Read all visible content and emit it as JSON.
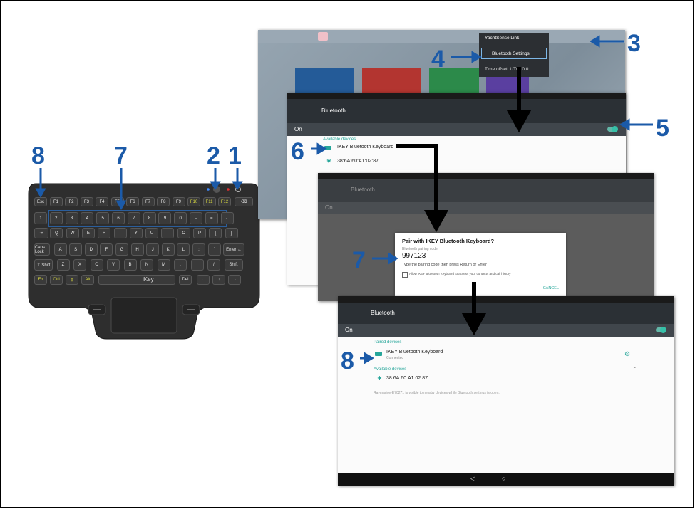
{
  "callouts": [
    "1",
    "2",
    "3",
    "4",
    "5",
    "6",
    "7",
    "8",
    "7",
    "8"
  ],
  "keyboard": {
    "brand": "iKey",
    "row_fn": [
      "Esc",
      "F1",
      "F2",
      "F3",
      "F4",
      "F5",
      "F6",
      "F7",
      "F8",
      "F9",
      "F10",
      "F11",
      "F12"
    ],
    "row_num": [
      "1",
      "2",
      "3",
      "4",
      "5",
      "6",
      "7",
      "8",
      "9",
      "0",
      "-",
      "=",
      "←"
    ],
    "row_q": [
      "⇥",
      "Q",
      "W",
      "E",
      "R",
      "T",
      "Y",
      "U",
      "I",
      "O",
      "P",
      "[",
      "]"
    ],
    "row_a": [
      "Caps Lock",
      "A",
      "S",
      "D",
      "F",
      "G",
      "H",
      "J",
      "K",
      "L",
      ";",
      "'",
      "Enter ←"
    ],
    "row_z": [
      "⇧ Shift",
      "Z",
      "X",
      "C",
      "V",
      "B",
      "N",
      "M",
      ",",
      ".",
      "/",
      "Shift"
    ],
    "row_b": [
      "Fn",
      "Ctrl",
      "⊞",
      "Alt",
      "Del",
      "←",
      "↓",
      "→"
    ]
  },
  "screen1": {
    "menu_items": [
      "YachtSense Link",
      "Bluetooth Settings",
      "Time offset: UTC: 0.0"
    ]
  },
  "screen2": {
    "title": "Bluetooth",
    "on_label": "On",
    "section": "Available devices",
    "device1": "IKEY Bluetooth Keyboard",
    "device2": "38:6A:60:A1:02:87"
  },
  "screen3": {
    "title": "Bluetooth",
    "on_label": "On",
    "dialog_title": "Pair with IKEY Bluetooth Keyboard?",
    "code_label": "Bluetooth pairing code",
    "code": "997123",
    "instruction": "Type the pairing code then press Return or Enter",
    "checkbox_label": "Allow IKEY Bluetooth Keyboard to access your contacts and call history",
    "cancel": "CANCEL"
  },
  "screen4": {
    "title": "Bluetooth",
    "on_label": "On",
    "paired_section": "Paired devices",
    "paired_device": "IKEY Bluetooth Keyboard",
    "paired_status": "Connected",
    "available_section": "Available devices",
    "available_device": "38:6A:60:A1:02:87",
    "footer_note": "Raymarine-E70271 is visible to nearby devices while Bluetooth settings is open."
  },
  "colors": {
    "callout": "#1b5aa8",
    "accent": "#26a69a",
    "actionbar": "#2b3035"
  }
}
